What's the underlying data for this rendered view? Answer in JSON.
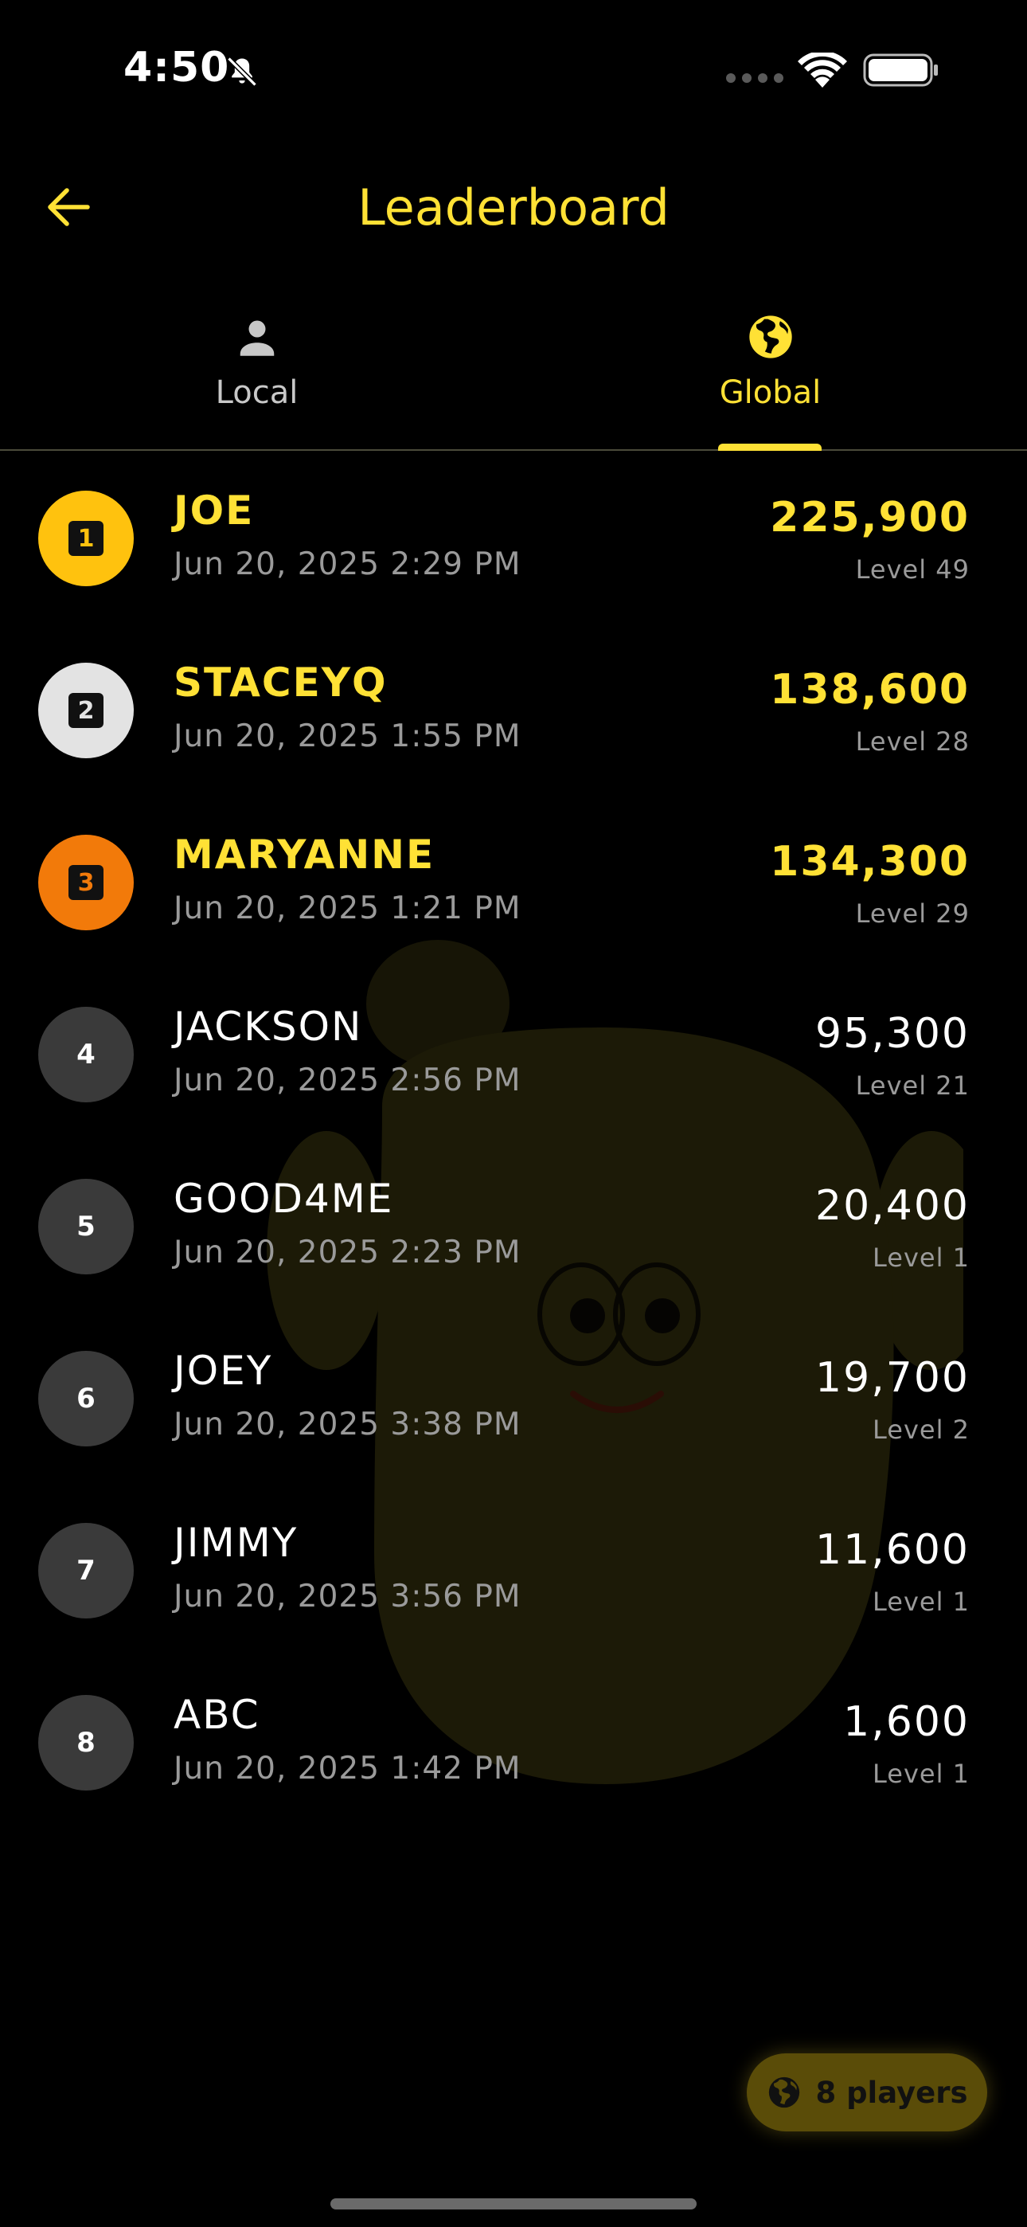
{
  "status_bar": {
    "time": "4:50"
  },
  "header": {
    "title": "Leaderboard"
  },
  "tabs": [
    {
      "label": "Local",
      "icon": "person-icon",
      "active": false
    },
    {
      "label": "Global",
      "icon": "globe-icon",
      "active": true
    }
  ],
  "colors": {
    "accent": "#FFE135",
    "gold": "#FFC20E",
    "silver": "#E3E3E3",
    "bronze": "#F27A0A",
    "default_rank": "#3A3A3A",
    "muted": "#9A9A9A"
  },
  "entries": [
    {
      "rank": "1",
      "name": "JOE",
      "date": "Jun 20, 2025 2:29 PM",
      "score": "225,900",
      "level": "Level 49"
    },
    {
      "rank": "2",
      "name": "STACEYQ",
      "date": "Jun 20, 2025 1:55 PM",
      "score": "138,600",
      "level": "Level 28"
    },
    {
      "rank": "3",
      "name": "MARYANNE",
      "date": "Jun 20, 2025 1:21 PM",
      "score": "134,300",
      "level": "Level 29"
    },
    {
      "rank": "4",
      "name": "JACKSON",
      "date": "Jun 20, 2025 2:56 PM",
      "score": "95,300",
      "level": "Level 21"
    },
    {
      "rank": "5",
      "name": "GOOD4ME",
      "date": "Jun 20, 2025 2:23 PM",
      "score": "20,400",
      "level": "Level 1"
    },
    {
      "rank": "6",
      "name": "JOEY",
      "date": "Jun 20, 2025 3:38 PM",
      "score": "19,700",
      "level": "Level 2"
    },
    {
      "rank": "7",
      "name": "JIMMY",
      "date": "Jun 20, 2025 3:56 PM",
      "score": "11,600",
      "level": "Level 1"
    },
    {
      "rank": "8",
      "name": "ABC",
      "date": "Jun 20, 2025 1:42 PM",
      "score": "1,600",
      "level": "Level 1"
    }
  ],
  "footer": {
    "players_label": "8 players"
  }
}
